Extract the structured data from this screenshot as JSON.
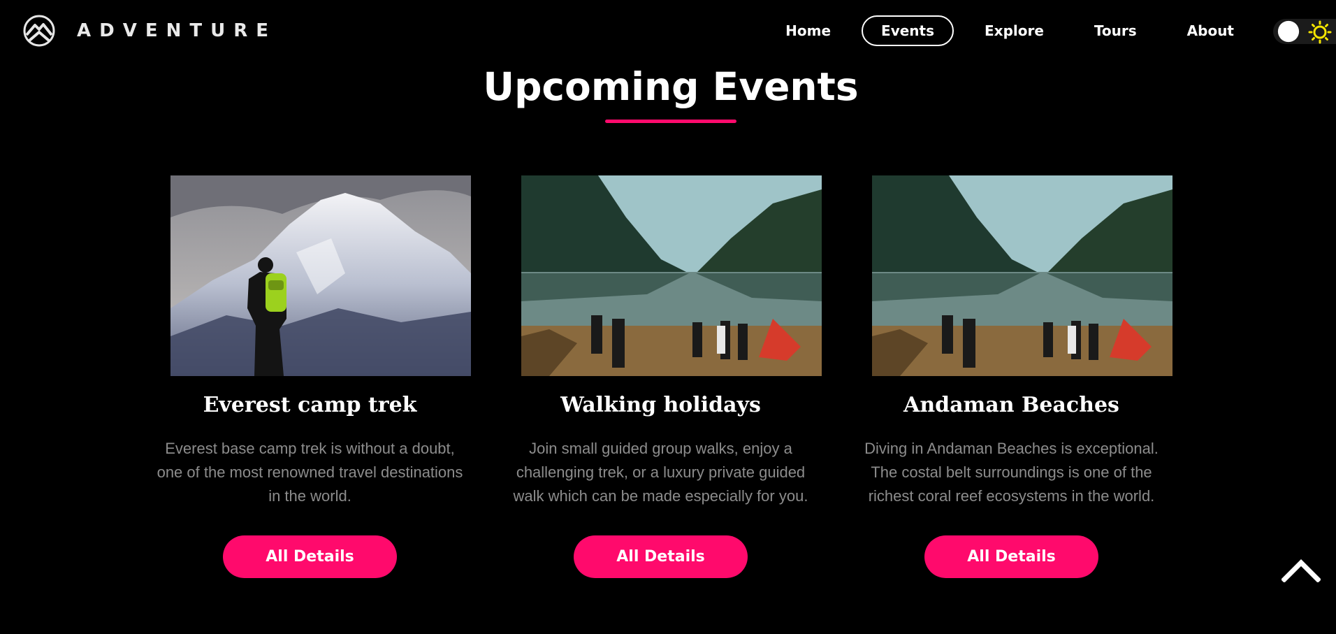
{
  "brand": {
    "name": "ADVENTURE",
    "icon": "mountain-logo-icon"
  },
  "nav": {
    "items": [
      {
        "label": "Home",
        "active": false
      },
      {
        "label": "Events",
        "active": true
      },
      {
        "label": "Explore",
        "active": false
      },
      {
        "label": "Tours",
        "active": false
      },
      {
        "label": "About",
        "active": false
      }
    ],
    "theme_toggle": {
      "icon": "sun-icon",
      "state": "light"
    }
  },
  "section": {
    "title": "Upcoming Events"
  },
  "events": [
    {
      "title": "Everest camp trek",
      "description": "Everest base camp trek is without a doubt, one of the most renowned travel destinations in the world.",
      "button": "All Details",
      "image": "snowy-mountain-hiker-image"
    },
    {
      "title": "Walking holidays",
      "description": "Join small guided group walks, enjoy a challenging trek, or a luxury private guided walk which can be made especially for you.",
      "button": "All Details",
      "image": "lake-camp-image"
    },
    {
      "title": "Andaman Beaches",
      "description": "Diving in Andaman Beaches is exceptional. The costal belt surroundings is one of the richest coral reef ecosystems in the world.",
      "button": "All Details",
      "image": "lake-camp-image"
    }
  ],
  "scroll_top": {
    "icon": "chevron-up-icon"
  },
  "colors": {
    "accent": "#ff0a6c",
    "background": "#000000",
    "text_muted": "#8c8c8c",
    "sun": "#f5e600"
  }
}
